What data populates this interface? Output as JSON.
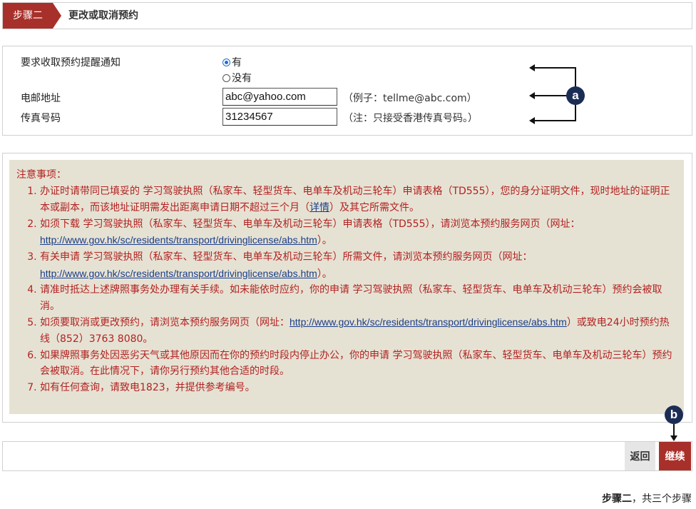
{
  "header": {
    "step_badge": "步骤二",
    "title": "更改或取消预约"
  },
  "form": {
    "reminder_label": "要求收取预约提醒通知",
    "reminder_options": [
      "有",
      "没有"
    ],
    "reminder_selected": "有",
    "email_label": "电邮地址",
    "email_value": "abc@yahoo.com",
    "email_hint": "（例子：tellme@abc.com）",
    "fax_label": "传真号码",
    "fax_value": "31234567",
    "fax_hint": "（注：只接受香港传真号码。）"
  },
  "callouts": {
    "a": "a",
    "b": "b"
  },
  "notes": {
    "heading": "注意事项：",
    "items": [
      {
        "pre": "办证时请带同已填妥的 学习驾驶执照（私家车、轻型货车、电单车及机动三轮车）申请表格（TD555），您的身分证明文件，现时地址的证明正本或副本，而该地址证明需发出距离申请日期不超过三个月（",
        "link": "详情",
        "post": "）及其它所需文件。"
      },
      {
        "pre": "如须下载 学习驾驶执照（私家车、轻型货车、电单车及机动三轮车）申请表格（TD555），请浏览本预约服务网页（网址：",
        "link": "http://www.gov.hk/sc/residents/transport/drivinglicense/abs.htm",
        "post": "）。"
      },
      {
        "pre": "有关申请 学习驾驶执照（私家车、轻型货车、电单车及机动三轮车）所需文件，请浏览本预约服务网页（网址：",
        "link": "http://www.gov.hk/sc/residents/transport/drivinglicense/abs.htm",
        "post": "）。"
      },
      {
        "pre": "请准时抵达上述牌照事务处办理有关手续。如未能依时应约，你的申请 学习驾驶执照（私家车、轻型货车、电单车及机动三轮车）预约会被取消。",
        "link": "",
        "post": ""
      },
      {
        "pre": "如须要取消或更改预约，请浏览本预约服务网页（网址：",
        "link": "http://www.gov.hk/sc/residents/transport/drivinglicense/abs.htm",
        "post": "）或致电24小时预约热线（852）3763 8080。"
      },
      {
        "pre": "如果牌照事务处因恶劣天气或其他原因而在你的预约时段内停止办公，你的申请 学习驾驶执照（私家车、轻型货车、电单车及机动三轮车）预约会被取消。在此情况下，请你另行预约其他合适的时段。",
        "link": "",
        "post": ""
      },
      {
        "pre": "如有任何查询，请致电1823，并提供参考编号。",
        "link": "",
        "post": ""
      }
    ]
  },
  "actions": {
    "back_label": "返回",
    "continue_label": "继续"
  },
  "footer": {
    "step_current": "步骤二",
    "step_total": "，共三个步骤"
  },
  "colors": {
    "accent": "#a8302a",
    "notes_text": "#b22222",
    "notes_bg": "#e6e2d3",
    "link": "#1a3d8a",
    "callout": "#1c2d55"
  }
}
